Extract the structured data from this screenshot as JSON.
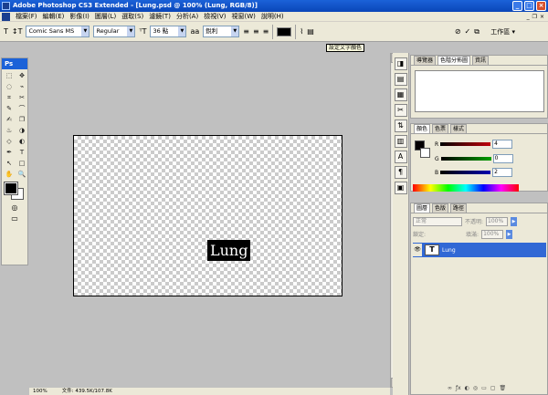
{
  "window": {
    "title": "Adobe Photoshop CS3 Extended - [Lung.psd @ 100% (Lung, RGB/8)]"
  },
  "menu": {
    "items": [
      "檔案(F)",
      "編輯(E)",
      "影像(I)",
      "圖層(L)",
      "選取(S)",
      "濾鏡(T)",
      "分析(A)",
      "檢視(V)",
      "視窗(W)",
      "說明(H)"
    ]
  },
  "options": {
    "tool_glyph": "T",
    "font_family": "Comic Sans MS",
    "font_style": "Regular",
    "font_size": "36 點",
    "aa_label": "aa",
    "aa_mode": "銳利",
    "workspace": "工作區 ▾"
  },
  "tooltip": {
    "text": "設定文字顏色"
  },
  "toolbox": {
    "logo": "Ps",
    "tools": [
      "⬚",
      "✥",
      "◌",
      "⌁",
      "⌗",
      "✂",
      "✎",
      "⌒",
      "✍",
      "❐",
      "♨",
      "◑",
      "◇",
      "◐",
      "✒",
      "T",
      "↖",
      "□",
      "✋",
      "🔍"
    ],
    "mode_icons": [
      "◎",
      "▭"
    ]
  },
  "document": {
    "text": "Lung"
  },
  "status": {
    "zoom": "100%",
    "doc_size": "文件: 439.5K/107.8K"
  },
  "dock": {
    "icons": [
      "◨",
      "▤",
      "▦",
      "✂",
      "⇅",
      "▥",
      "A",
      "¶",
      "▣"
    ]
  },
  "navigator": {
    "tabs": [
      "導覽器",
      "色階分佈圖",
      "資訊"
    ]
  },
  "color_panel": {
    "tabs": [
      "顏色",
      "色票",
      "樣式"
    ],
    "channels": [
      {
        "label": "R",
        "value": "4",
        "color": "#c0000c"
      },
      {
        "label": "G",
        "value": "0",
        "color": "#00a000"
      },
      {
        "label": "B",
        "value": "2",
        "color": "#0000b0"
      }
    ],
    "foreground": "#040002"
  },
  "layers": {
    "tabs": [
      "圖層",
      "色版",
      "路徑"
    ],
    "blend": "正常",
    "opacity_label": "不透明:",
    "opacity": "100%",
    "lock_label": "鎖定:",
    "fill_label": "填滿:",
    "fill": "100%",
    "layer_name": "Lung",
    "thumb": "T",
    "eye": "👁",
    "bottom_icons": [
      "∞",
      "ƒx",
      "◐",
      "◎",
      "▭",
      "▢",
      "🗑"
    ]
  }
}
